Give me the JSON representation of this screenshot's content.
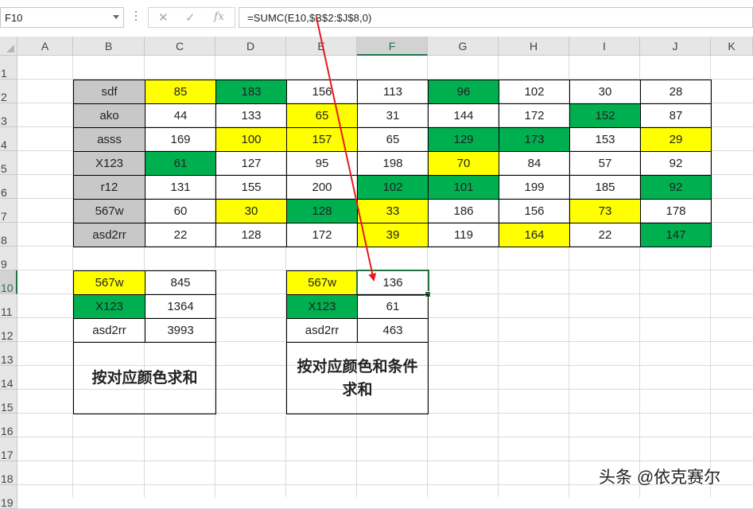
{
  "formula_bar": {
    "name_box": "F10",
    "cancel_icon": "✕",
    "enter_icon": "✓",
    "fx_icon": "fx",
    "formula": "=SUMC(E10,$B$2:$J$8,0)"
  },
  "columns": [
    "A",
    "B",
    "C",
    "D",
    "E",
    "F",
    "G",
    "H",
    "I",
    "J",
    "K"
  ],
  "selected_column": "F",
  "rows": [
    "1",
    "2",
    "3",
    "4",
    "5",
    "6",
    "7",
    "8",
    "9",
    "10",
    "11",
    "12",
    "13",
    "14",
    "15",
    "16",
    "17",
    "18",
    "19"
  ],
  "selected_row": "10",
  "main_table": [
    [
      {
        "v": "sdf",
        "c": "gray"
      },
      {
        "v": "85",
        "c": "yel"
      },
      {
        "v": "183",
        "c": "grn"
      },
      {
        "v": "156",
        "c": ""
      },
      {
        "v": "113",
        "c": ""
      },
      {
        "v": "96",
        "c": "grn"
      },
      {
        "v": "102",
        "c": ""
      },
      {
        "v": "30",
        "c": ""
      },
      {
        "v": "28",
        "c": ""
      }
    ],
    [
      {
        "v": "ako",
        "c": "gray"
      },
      {
        "v": "44",
        "c": ""
      },
      {
        "v": "133",
        "c": ""
      },
      {
        "v": "65",
        "c": "yel"
      },
      {
        "v": "31",
        "c": ""
      },
      {
        "v": "144",
        "c": ""
      },
      {
        "v": "172",
        "c": ""
      },
      {
        "v": "152",
        "c": "grn"
      },
      {
        "v": "87",
        "c": ""
      }
    ],
    [
      {
        "v": "asss",
        "c": "gray"
      },
      {
        "v": "169",
        "c": ""
      },
      {
        "v": "100",
        "c": "yel"
      },
      {
        "v": "157",
        "c": "yel"
      },
      {
        "v": "65",
        "c": ""
      },
      {
        "v": "129",
        "c": "grn"
      },
      {
        "v": "173",
        "c": "grn"
      },
      {
        "v": "153",
        "c": ""
      },
      {
        "v": "29",
        "c": "yel"
      }
    ],
    [
      {
        "v": "X123",
        "c": "gray"
      },
      {
        "v": "61",
        "c": "grn"
      },
      {
        "v": "127",
        "c": ""
      },
      {
        "v": "95",
        "c": ""
      },
      {
        "v": "198",
        "c": ""
      },
      {
        "v": "70",
        "c": "yel"
      },
      {
        "v": "84",
        "c": ""
      },
      {
        "v": "57",
        "c": ""
      },
      {
        "v": "92",
        "c": ""
      }
    ],
    [
      {
        "v": "r12",
        "c": "gray"
      },
      {
        "v": "131",
        "c": ""
      },
      {
        "v": "155",
        "c": ""
      },
      {
        "v": "200",
        "c": ""
      },
      {
        "v": "102",
        "c": "grn"
      },
      {
        "v": "101",
        "c": "grn"
      },
      {
        "v": "199",
        "c": ""
      },
      {
        "v": "185",
        "c": ""
      },
      {
        "v": "92",
        "c": "grn"
      }
    ],
    [
      {
        "v": "567w",
        "c": "gray"
      },
      {
        "v": "60",
        "c": ""
      },
      {
        "v": "30",
        "c": "yel"
      },
      {
        "v": "128",
        "c": "grn"
      },
      {
        "v": "33",
        "c": "yel"
      },
      {
        "v": "186",
        "c": ""
      },
      {
        "v": "156",
        "c": ""
      },
      {
        "v": "73",
        "c": "yel"
      },
      {
        "v": "178",
        "c": ""
      }
    ],
    [
      {
        "v": "asd2rr",
        "c": "gray"
      },
      {
        "v": "22",
        "c": ""
      },
      {
        "v": "128",
        "c": ""
      },
      {
        "v": "172",
        "c": ""
      },
      {
        "v": "39",
        "c": "yel"
      },
      {
        "v": "119",
        "c": ""
      },
      {
        "v": "164",
        "c": "yel"
      },
      {
        "v": "22",
        "c": ""
      },
      {
        "v": "147",
        "c": "grn"
      }
    ]
  ],
  "color_sum_table": {
    "rows": [
      {
        "label": "567w",
        "label_color": "yel",
        "value": "845"
      },
      {
        "label": "X123",
        "label_color": "grn",
        "value": "1364"
      },
      {
        "label": "asd2rr",
        "label_color": "",
        "value": "3993"
      }
    ],
    "caption": "按对应颜色求和"
  },
  "color_cond_sum_table": {
    "rows": [
      {
        "label": "567w",
        "label_color": "yel",
        "value": "136"
      },
      {
        "label": "X123",
        "label_color": "grn",
        "value": "61"
      },
      {
        "label": "asd2rr",
        "label_color": "",
        "value": "463"
      }
    ],
    "caption_line1": "按对应颜色和条件",
    "caption_line2": "求和"
  },
  "watermark": "头条 @依克赛尔",
  "colors": {
    "yellow": "#ffff00",
    "green": "#00b050",
    "gray": "#c8c8c8",
    "accent": "#217346",
    "arrow": "#e8191c"
  }
}
